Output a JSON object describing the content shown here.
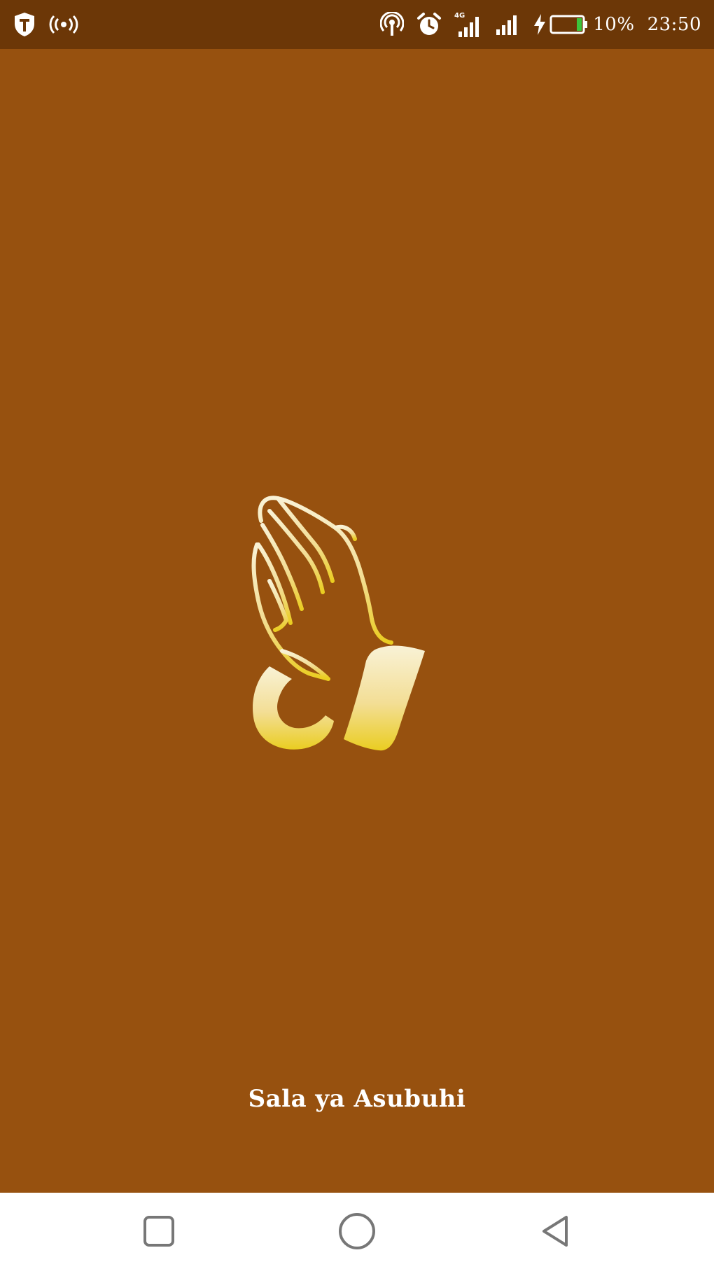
{
  "status_bar": {
    "battery_percent": "10%",
    "time": "23:50",
    "network_type": "4G",
    "battery_level": 0.1,
    "icons": {
      "left": [
        "shield-t-icon",
        "broadcast-icon"
      ],
      "right": [
        "hotspot-icon",
        "alarm-clock-icon",
        "signal-4g-icon",
        "signal-icon",
        "charging-icon",
        "battery-icon"
      ]
    }
  },
  "splash": {
    "logo_icon": "praying-hands-icon",
    "title": "Sala ya Asubuhi"
  },
  "nav_bar": {
    "buttons": [
      "recents-button",
      "home-button",
      "back-button"
    ]
  },
  "colors": {
    "status_bar_bg": "#6C3707",
    "background": "#97510F",
    "logo_gold_top": "#F6E7B8",
    "logo_gold_bottom": "#EACD21",
    "title_text": "#FFFFFF",
    "nav_bar_bg": "#FFFFFF",
    "nav_icon": "#777777",
    "battery_fill": "#3CC43C"
  }
}
